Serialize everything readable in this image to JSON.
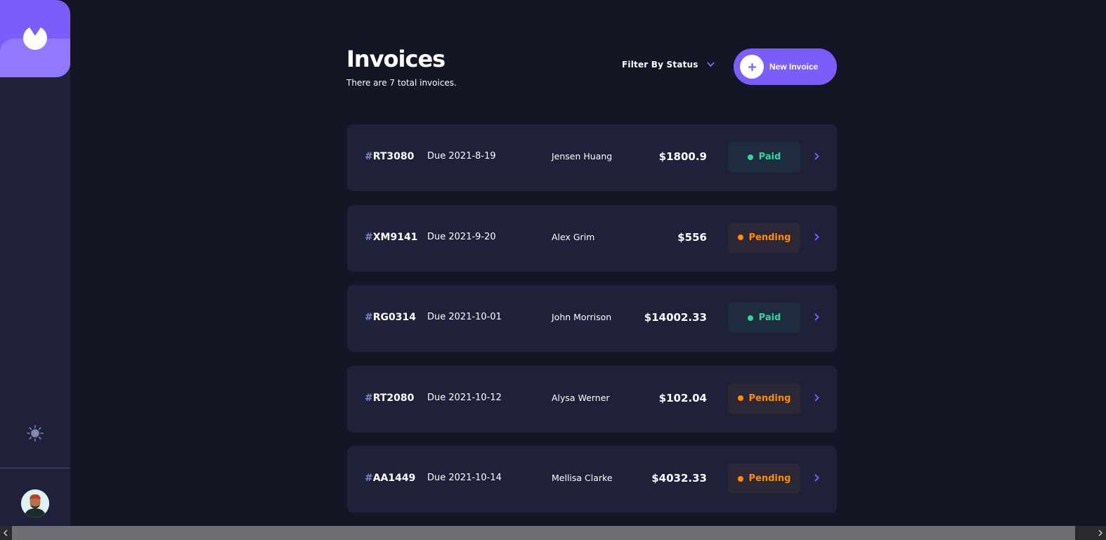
{
  "header": {
    "title": "Invoices",
    "subtitle": "There are 7 total invoices.",
    "filter_label": "Filter By Status",
    "new_invoice_label": "New Invoice"
  },
  "invoices": [
    {
      "hash": "#",
      "id": "RT3080",
      "due": "Due 2021-8-19",
      "client": "Jensen Huang",
      "amount": "$1800.9",
      "status": "Paid"
    },
    {
      "hash": "#",
      "id": "XM9141",
      "due": "Due 2021-9-20",
      "client": "Alex Grim",
      "amount": "$556",
      "status": "Pending"
    },
    {
      "hash": "#",
      "id": "RG0314",
      "due": "Due 2021-10-01",
      "client": "John Morrison",
      "amount": "$14002.33",
      "status": "Paid"
    },
    {
      "hash": "#",
      "id": "RT2080",
      "due": "Due 2021-10-12",
      "client": "Alysa Werner",
      "amount": "$102.04",
      "status": "Pending"
    },
    {
      "hash": "#",
      "id": "AA1449",
      "due": "Due 2021-10-14",
      "client": "Mellisa Clarke",
      "amount": "$4032.33",
      "status": "Pending"
    }
  ],
  "icons": {
    "logo": "logo-icon",
    "theme_toggle": "sun-icon",
    "filter": "chevron-down-icon",
    "new_invoice": "plus-icon",
    "row_arrow": "chevron-right-icon"
  },
  "colors": {
    "accent": "#7c5dfa",
    "accent_light": "#9277ff",
    "background": "#141625",
    "card": "#1e2139",
    "paid": "#33d69f",
    "pending": "#ff8f00",
    "muted": "#7e88c3"
  }
}
